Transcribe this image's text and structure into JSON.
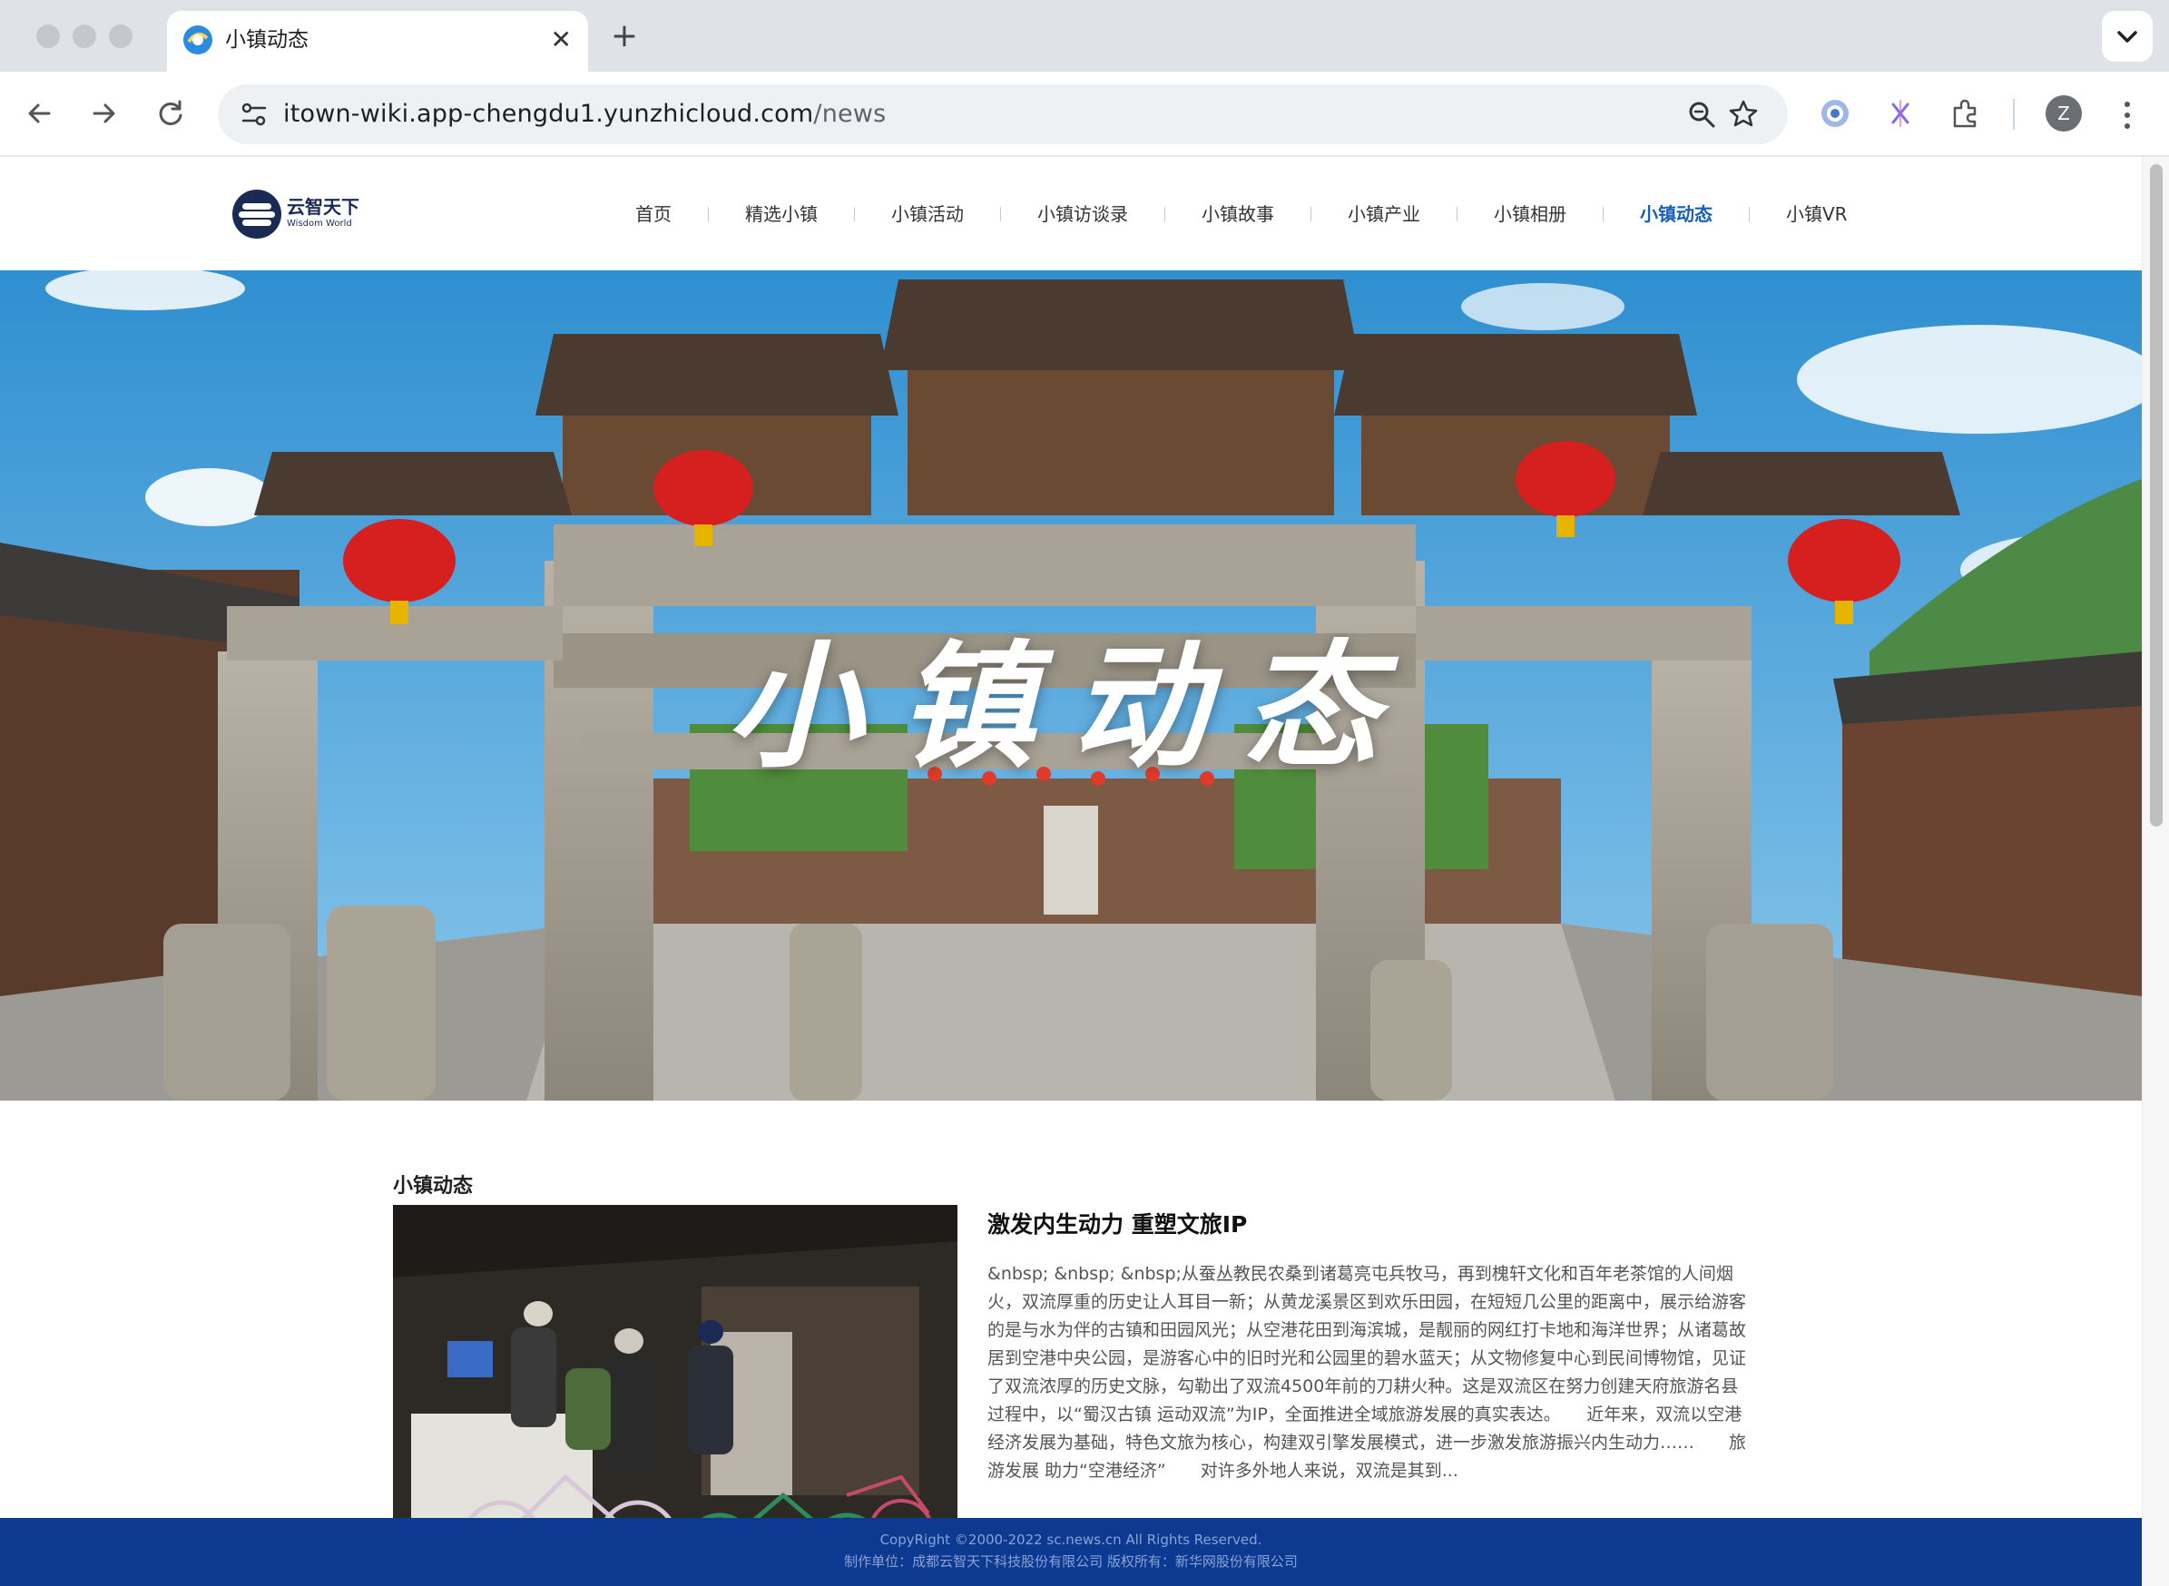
{
  "browser": {
    "tab_title": "小镇动态",
    "url_host": "itown-wiki.app-chengdu1.yunzhicloud.com",
    "url_path": "/news",
    "avatar_initial": "Z",
    "accent_color": "#1a73e8"
  },
  "site": {
    "logo_name": "云智天下",
    "logo_subtitle": "Wisdom World",
    "nav": [
      {
        "label": "首页",
        "active": false
      },
      {
        "label": "精选小镇",
        "active": false
      },
      {
        "label": "小镇活动",
        "active": false
      },
      {
        "label": "小镇访谈录",
        "active": false
      },
      {
        "label": "小镇故事",
        "active": false
      },
      {
        "label": "小镇产业",
        "active": false
      },
      {
        "label": "小镇相册",
        "active": false
      },
      {
        "label": "小镇动态",
        "active": true
      },
      {
        "label": "小镇VR",
        "active": false
      }
    ],
    "active_nav_color": "#1a5fb4"
  },
  "banner": {
    "title": "小镇动态"
  },
  "news": {
    "section_title": "小镇动态",
    "items": [
      {
        "title": "激发内生动力 重塑文旅IP",
        "summary": "&nbsp; &nbsp; &nbsp;从蚕丛教民农桑到诸葛亮屯兵牧马，再到槐轩文化和百年老茶馆的人间烟火，双流厚重的历史让人耳目一新；从黄龙溪景区到欢乐田园，在短短几公里的距离中，展示给游客的是与水为伴的古镇和田园风光；从空港花田到海滨城，是靓丽的网红打卡地和海洋世界；从诸葛故居到空港中央公园，是游客心中的旧时光和公园里的碧水蓝天；从文物修复中心到民间博物馆，见证了双流浓厚的历史文脉，勾勒出了双流4500年前的刀耕火种。这是双流区在努力创建天府旅游名县过程中，以“蜀汉古镇 运动双流”为IP，全面推进全域旅游发展的真实表达。　　近年来，双流以空港经济发展为基础，特色文旅为核心，构建双引擎发展模式，进一步激发旅游振兴内生动力……　　旅游发展 助力“空港经济”　　对许多外地人来说，双流是其到..."
      }
    ]
  },
  "footer": {
    "copyright": "CopyRight ©2000-2022 sc.news.cn All Rights Reserved.",
    "credits": "制作单位：成都云智天下科技股份有限公司 版权所有：新华网股份有限公司",
    "background_color": "#0d3a91"
  }
}
